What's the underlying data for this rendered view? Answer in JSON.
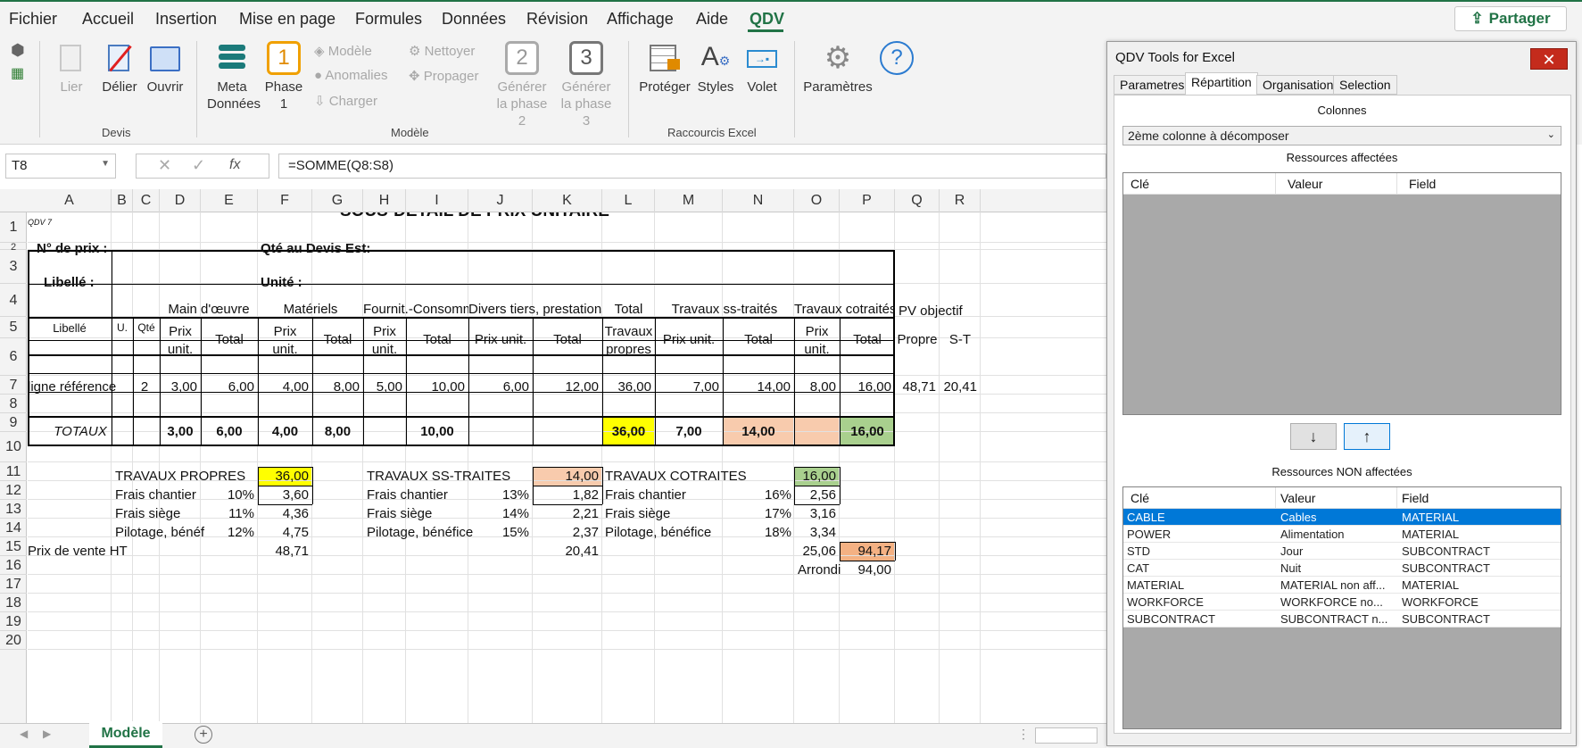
{
  "menu": [
    "Fichier",
    "Accueil",
    "Insertion",
    "Mise en page",
    "Formules",
    "Données",
    "Révision",
    "Affichage",
    "Aide",
    "QDV"
  ],
  "share_label": "Partager",
  "ribbon": {
    "lier": "Lier",
    "delier": "Délier",
    "ouvrir": "Ouvrir",
    "group_devis": "Devis",
    "meta": "Meta",
    "donnees": "Données",
    "phase1_num": "1",
    "phase": "Phase",
    "phase1": "1",
    "modele": "Modèle",
    "anomalies": "Anomalies",
    "charger": "Charger",
    "nettoyer": "Nettoyer",
    "propager": "Propager",
    "phase2_num": "2",
    "gen2_a": "Générer",
    "gen2_b": "la phase 2",
    "phase3_num": "3",
    "gen3_a": "Générer",
    "gen3_b": "la phase 3",
    "group_modele": "Modèle",
    "proteger": "Protéger",
    "styles": "Styles",
    "volet": "Volet",
    "group_raccourcis": "Raccourcis Excel",
    "parametres": "Paramètres"
  },
  "formula_bar": {
    "namebox": "T8",
    "fx": "fx",
    "formula": "=SOMME(Q8:S8)"
  },
  "columns": [
    "A",
    "B",
    "C",
    "D",
    "E",
    "F",
    "G",
    "H",
    "I",
    "J",
    "K",
    "L",
    "M",
    "N",
    "O",
    "P",
    "Q",
    "R"
  ],
  "rows": [
    "1",
    "2",
    "3",
    "4",
    "5",
    "6",
    "7",
    "8",
    "9",
    "10",
    "11",
    "12",
    "13",
    "14",
    "15",
    "16",
    "17",
    "18",
    "19",
    "20"
  ],
  "sheet": {
    "title": "SOUS-DETAIL DE PRIX UNITAIRE",
    "qdv7": "QDV 7",
    "no_prix": "N° de prix :",
    "qte_devis": "Qté au Devis Est:",
    "libelle_lbl": "Libellé :",
    "unite_lbl": "Unité :",
    "hdr_libelle": "Libellé",
    "hdr_u": "U.",
    "hdr_qte": "Qté",
    "hdr_mo": "Main d'œuvre",
    "hdr_mat": "Matériels",
    "hdr_fourn": "Fournit.-Consomm",
    "hdr_divers": "Divers tiers, prestations",
    "hdr_total": "Total",
    "hdr_ss": "Travaux ss-traités",
    "hdr_cot": "Travaux cotraités",
    "hdr_pv": "PV objectif",
    "prix": "Prix",
    "unit": "unit.",
    "total": "Total",
    "prix_unit": "Prix unit.",
    "travaux": "Travaux",
    "propres": "propres",
    "propre": "Propre",
    "st": "S-T",
    "row8": [
      "ligne référence",
      "2",
      "3,00",
      "6,00",
      "4,00",
      "8,00",
      "5,00",
      "10,00",
      "6,00",
      "12,00",
      "36,00",
      "7,00",
      "14,00",
      "8,00",
      "16,00",
      "48,71",
      "20,41"
    ],
    "totaux": "TOTAUX",
    "row10": [
      "3,00",
      "6,00",
      "4,00",
      "8,00",
      "10,00",
      "36,00",
      "7,00",
      "14,00",
      "16,00"
    ],
    "tp": "TRAVAUX PROPRES",
    "tp_val": "36,00",
    "tst": "TRAVAUX SS-TRAITES",
    "tst_val": "14,00",
    "tc": "TRAVAUX COTRAITES",
    "tc_val": "16,00",
    "frais_chantier": "Frais chantier",
    "frais_siege": "Frais siège",
    "pilotage1": "Pilotage, bénéf",
    "pilotage2": "Pilotage, bénéfice",
    "p10": "10%",
    "p11": "11%",
    "p12": "12%",
    "p13": "13%",
    "p14": "14%",
    "p15": "15%",
    "p16": "16%",
    "p17": "17%",
    "p18": "18%",
    "v13a": "3,60",
    "v14a": "4,36",
    "v15a": "4,75",
    "v13b": "1,82",
    "v14b": "2,21",
    "v15b": "2,37",
    "v13c": "2,56",
    "v14c": "3,16",
    "v15c": "3,34",
    "prix_vente": "Prix de vente HT",
    "pv_a": "48,71",
    "pv_b": "20,41",
    "pv_c": "25,06",
    "pv_total": "94,17",
    "arrondi": "Arrondi",
    "arrondi_val": "94,00"
  },
  "sheet_tab": "Modèle",
  "panel": {
    "title": "QDV Tools for Excel",
    "tabs": [
      "Parametres",
      "Répartition",
      "Organisation",
      "Selection"
    ],
    "colonnes": "Colonnes",
    "combo": "2ème colonne à décomposer",
    "ress_aff": "Ressources affectées",
    "ress_non": "Ressources NON affectées",
    "headers": [
      "Clé",
      "Valeur",
      "Field"
    ],
    "rows": [
      [
        "CABLE",
        "Cables",
        "MATERIAL"
      ],
      [
        "POWER",
        "Alimentation",
        "MATERIAL"
      ],
      [
        "STD",
        "Jour",
        "SUBCONTRACT"
      ],
      [
        "CAT",
        "Nuit",
        "SUBCONTRACT"
      ],
      [
        "MATERIAL",
        "MATERIAL non aff...",
        "MATERIAL"
      ],
      [
        "WORKFORCE",
        "WORKFORCE no...",
        "WORKFORCE"
      ],
      [
        "SUBCONTRACT",
        "SUBCONTRACT n...",
        "SUBCONTRACT"
      ]
    ],
    "down": "↓",
    "up": "↑"
  },
  "colors": {
    "excel_green": "#217346",
    "yellow": "#ffff00",
    "salmon": "#f8cbad",
    "green_fill": "#a9d08e",
    "orange": "#f4b183",
    "selection": "#0078d7"
  }
}
